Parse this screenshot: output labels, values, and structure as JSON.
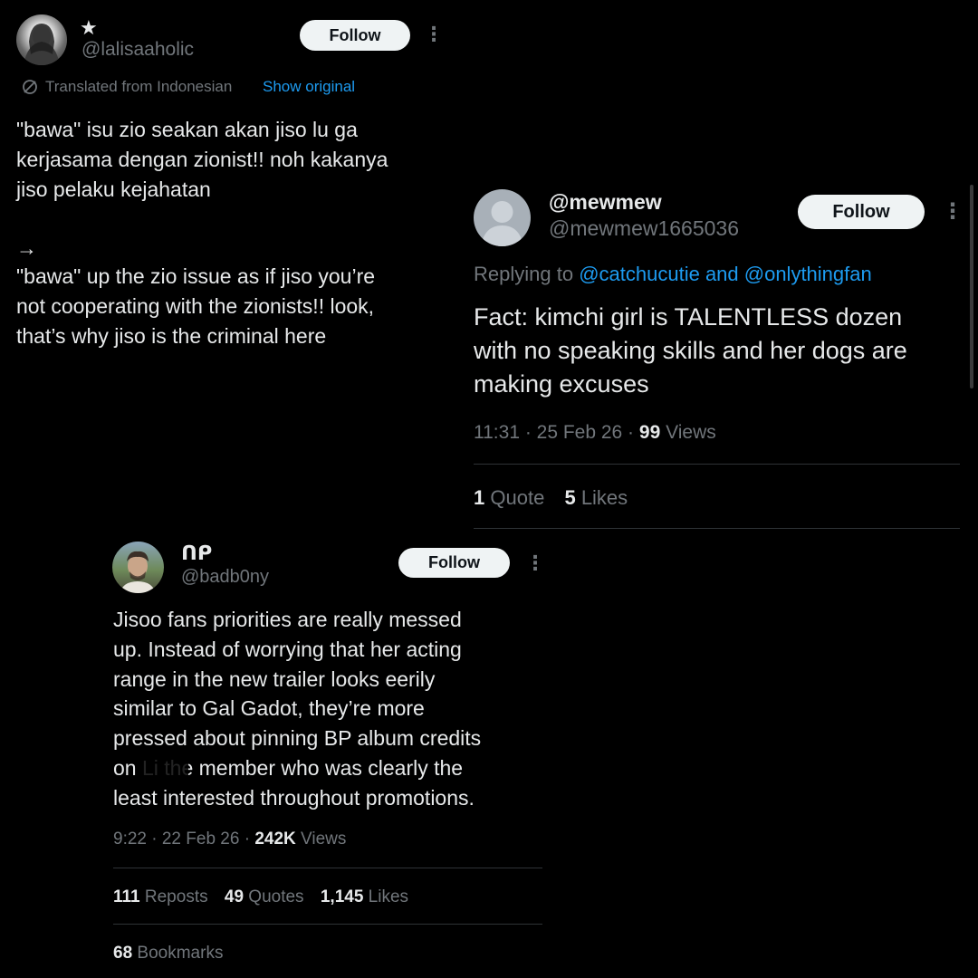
{
  "tweet1": {
    "display_name": "★",
    "handle": "@lalisaaholic",
    "follow_label": "Follow",
    "more_label": "⋮",
    "translated_text": "Translated from Indonesian",
    "show_original": "Show original",
    "original_text": "\"bawa\" isu zio seakan akan jiso lu ga\nkerjasama dengan zionist!! noh kakanya\njiso pelaku kejahatan",
    "arrow": "→",
    "translated_body": "\"bawa\" up the zio issue as if jiso you’re\nnot cooperating with the zionists!! look,\nthat’s why jiso is the criminal here"
  },
  "tweet2": {
    "display_name": "@mewmew",
    "handle": "@mewmew1665036",
    "follow_label": "Follow",
    "more_label": "⋮",
    "replying_prefix": "Replying to",
    "replying_to": "@catchucutie and @onlythingfan",
    "body": "Fact: kimchi girl is TALENTLESS dozen\nwith no speaking skills and her dogs are\nmaking excuses",
    "time": "11:31 · 25 Feb 26 ·",
    "views_count": "99",
    "views_label": "Views",
    "quotes_count": "1",
    "quotes_label": "Quote",
    "likes_count": "5",
    "likes_label": "Likes"
  },
  "tweet3": {
    "display_name": "ᑎᑭ",
    "handle": "@badb0ny",
    "follow_label": "Follow",
    "more_label": "⋮",
    "body": "Jisoo fans priorities are really messed\nup. Instead of worrying that her acting\nrange in the new trailer looks eerily\nsimilar to Gal Gadot, they’re more\npressed about pinning BP album credits\non Li    the member who was clearly the\nleast interested throughout promotions.",
    "time": "9:22 · 22 Feb 26 ·",
    "views_count": "242K",
    "views_label": "Views",
    "reposts_count": "111",
    "reposts_label": "Reposts",
    "quotes_count": "49",
    "quotes_label": "Quotes",
    "likes_count": "1,145",
    "likes_label": "Likes",
    "bookmarks_count": "68",
    "bookmarks_label": "Bookmarks"
  },
  "colors": {
    "background": "#000000",
    "text": "#e7e9ea",
    "muted": "#71767b",
    "link": "#1d9bf0",
    "button": "#eff3f4"
  }
}
